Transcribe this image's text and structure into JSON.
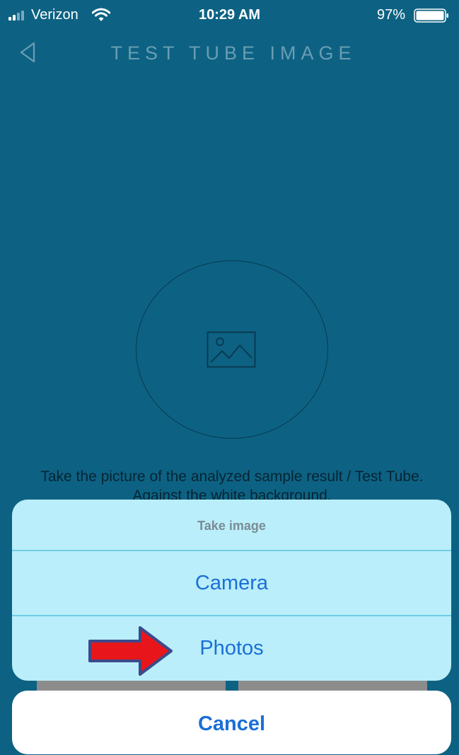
{
  "status_bar": {
    "carrier": "Verizon",
    "time": "10:29 AM",
    "battery_percent": "97%",
    "signal_icon": "signal-bars-icon",
    "wifi_icon": "wifi-icon",
    "battery_icon": "battery-icon"
  },
  "nav": {
    "back_icon": "chevron-left-icon",
    "title": "TEST TUBE IMAGE"
  },
  "main": {
    "image_placeholder_icon": "image-icon",
    "instruction": "Take the picture of the analyzed sample result / Test Tube. Against the white background."
  },
  "action_sheet": {
    "title": "Take image",
    "options": [
      {
        "label": "Camera"
      },
      {
        "label": "Photos"
      }
    ],
    "cancel_label": "Cancel"
  },
  "annotation": {
    "arrow_icon": "right-arrow-icon",
    "arrow_color": "#e8161b"
  },
  "colors": {
    "background": "#0d6283",
    "sheet_background": "#b9eefa",
    "accent": "#1b6fd6"
  }
}
